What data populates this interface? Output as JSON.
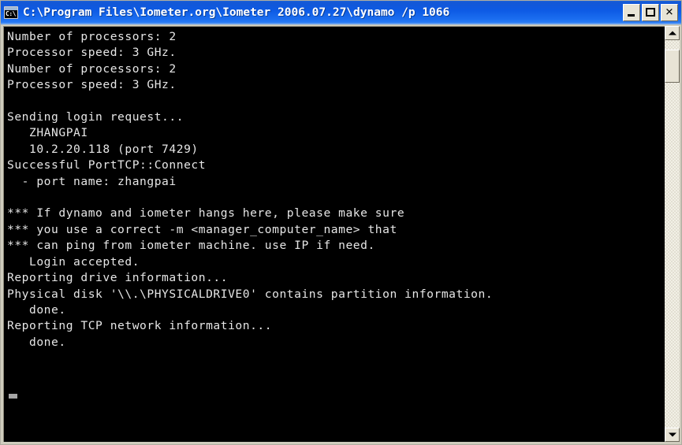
{
  "window": {
    "title": "C:\\Program Files\\Iometer.org\\Iometer 2006.07.27\\dynamo /p 1066",
    "system_icon": "console-icon",
    "icon_prompt": "C:\\",
    "controls": {
      "minimize_label": "_",
      "maximize_label": "□",
      "close_label": "✕"
    },
    "colors": {
      "titlebar_blue": "#0d5ae4",
      "frame_beige": "#d6d3c4",
      "console_background": "#000000",
      "console_text": "#e6e6e6",
      "button_face": "#e8e4d6"
    }
  },
  "console": {
    "text": "Number of processors: 2\nProcessor speed: 3 GHz.\nNumber of processors: 2\nProcessor speed: 3 GHz.\n\nSending login request...\n   ZHANGPAI\n   10.2.20.118 (port 7429)\nSuccessful PortTCP::Connect\n  - port name: zhangpai\n\n*** If dynamo and iometer hangs here, please make sure\n*** you use a correct -m <manager_computer_name> that\n*** can ping from iometer machine. use IP if need.\n   Login accepted.\nReporting drive information...\nPhysical disk '\\\\.\\PHYSICALDRIVE0' contains partition information.\n   done.\nReporting TCP network information...\n   done.",
    "lines": [
      "Number of processors: 2",
      "Processor speed: 3 GHz.",
      "Number of processors: 2",
      "Processor speed: 3 GHz.",
      "",
      "Sending login request...",
      "   ZHANGPAI",
      "   10.2.20.118 (port 7429)",
      "Successful PortTCP::Connect",
      "  - port name: zhangpai",
      "",
      "*** If dynamo and iometer hangs here, please make sure",
      "*** you use a correct -m <manager_computer_name> that",
      "*** can ping from iometer machine. use IP if need.",
      "   Login accepted.",
      "Reporting drive information...",
      "Physical disk '\\\\.\\PHYSICALDRIVE0' contains partition information.",
      "   done.",
      "Reporting TCP network information...",
      "   done."
    ]
  },
  "scrollbar": {
    "up_arrow": "scroll-up-arrow",
    "down_arrow": "scroll-down-arrow",
    "thumb": "scroll-thumb"
  }
}
